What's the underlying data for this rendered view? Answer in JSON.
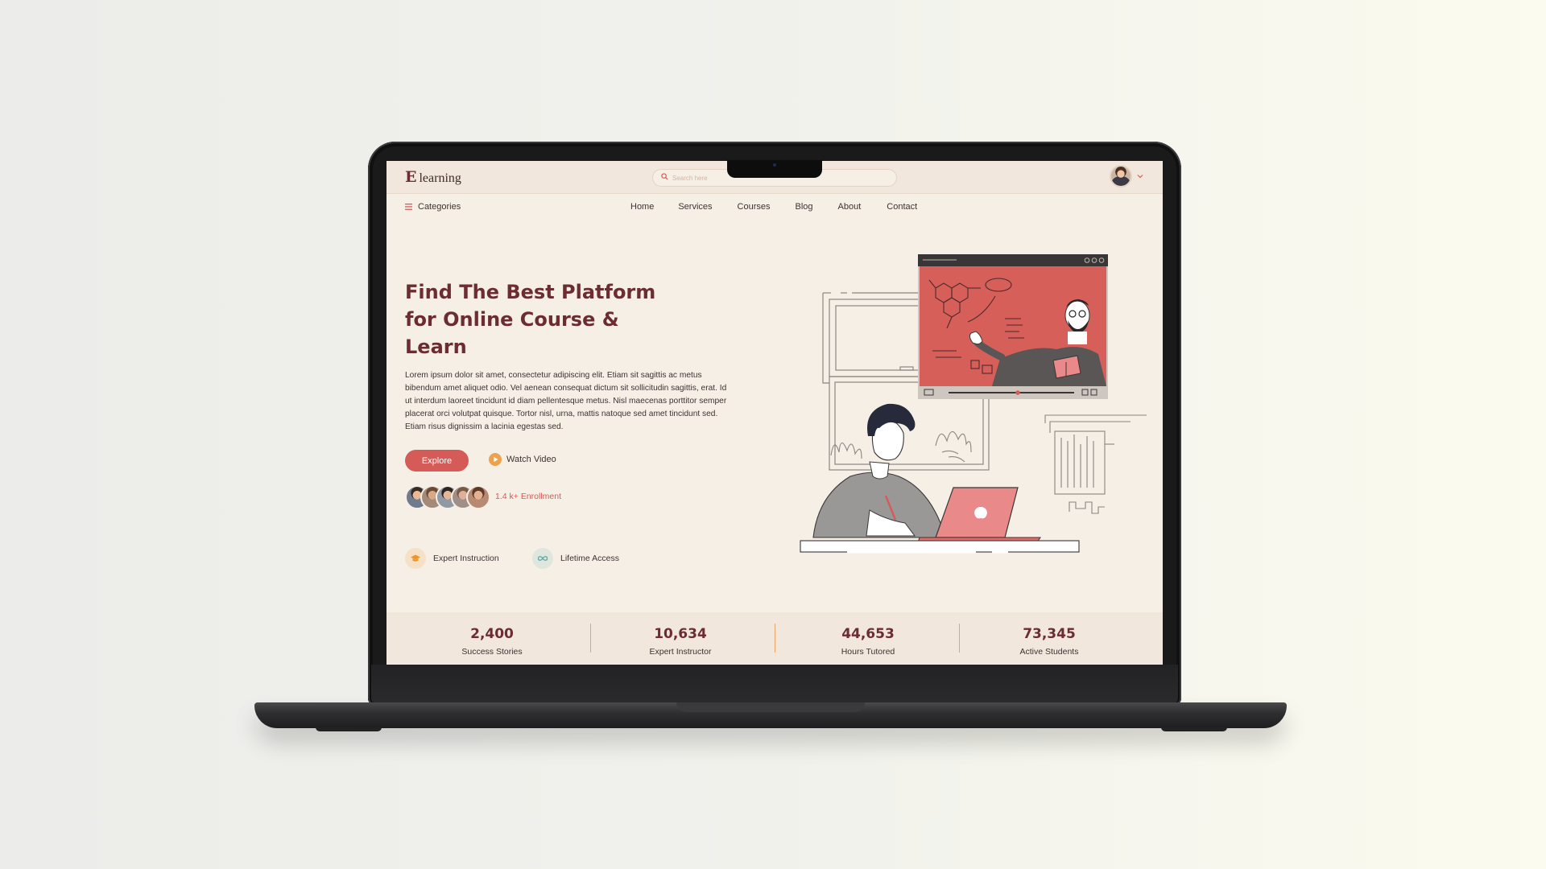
{
  "colors": {
    "accent": "#d45b57",
    "title": "#6b2c32",
    "background": "#f6efe6",
    "topbar": "#f1e7dc",
    "divider": "#e8a66a"
  },
  "brand": {
    "logo_mark": "E",
    "logo_text": "learning"
  },
  "search": {
    "placeholder": "Search here"
  },
  "navbar": {
    "categories_label": "Categories",
    "links": [
      "Home",
      "Services",
      "Courses",
      "Blog",
      "About",
      "Contact"
    ]
  },
  "hero": {
    "title": "Find The Best Platform for Online Course & Learn",
    "description": "Lorem ipsum dolor sit amet, consectetur adipiscing elit. Etiam sit sagittis ac metus bibendum amet aliquet odio. Vel aenean consequat dictum sit sollicitudin sagittis, erat. Id ut interdum laoreet tincidunt id diam pellentesque metus. Nisl maecenas porttitor semper placerat orci volutpat quisque. Tortor nisl, urna, mattis natoque sed amet tincidunt sed. Etiam risus dignissim a lacinia egestas sed.",
    "explore_label": "Explore",
    "watch_label": "Watch Video",
    "enrollment_text": "1.4 k+ Enrollment"
  },
  "features": [
    {
      "label": "Expert Instruction",
      "icon": "graduation-cap-icon"
    },
    {
      "label": "Lifetime Access",
      "icon": "infinity-icon"
    }
  ],
  "stats": [
    {
      "value": "2,400",
      "label": "Success Stories"
    },
    {
      "value": "10,634",
      "label": "Expert Instructor"
    },
    {
      "value": "44,653",
      "label": "Hours Tutored"
    },
    {
      "value": "73,345",
      "label": "Active Students"
    }
  ]
}
